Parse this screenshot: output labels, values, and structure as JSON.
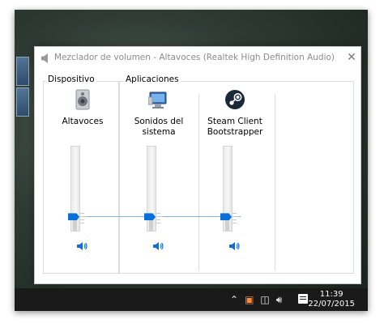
{
  "window": {
    "title": "Mezclador de volumen - Altavoces (Realtek High Definition Audio)",
    "close_glyph": "✕"
  },
  "groups": {
    "device_label": "Dispositivo",
    "apps_label": "Aplicaciones"
  },
  "channels": [
    {
      "name_line1": "Altavoces",
      "name_line2": "",
      "icon": "speaker-device-icon",
      "volume_fraction": 0.16
    },
    {
      "name_line1": "Sonidos del",
      "name_line2": "sistema",
      "icon": "system-sounds-icon",
      "volume_fraction": 0.16
    },
    {
      "name_line1": "Steam Client",
      "name_line2": "Bootstrapper",
      "icon": "steam-icon",
      "volume_fraction": 0.16
    }
  ],
  "taskbar": {
    "time": "11:39",
    "date": "22/07/2015"
  },
  "colors": {
    "accent": "#0a6fd8",
    "link_line": "#7fb3e3",
    "taskbar": "#1a1a1a"
  }
}
